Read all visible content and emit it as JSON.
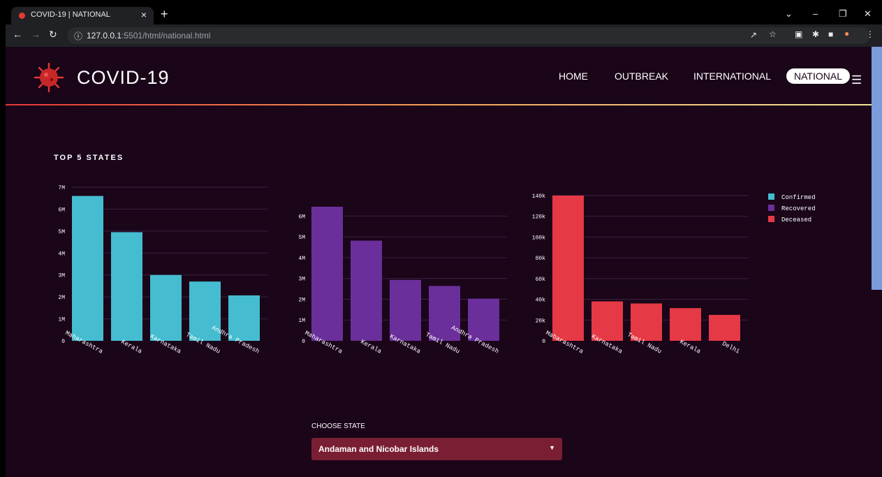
{
  "browser": {
    "tab_title": "COVID-19 | NATIONAL",
    "tab_close": "×",
    "new_tab": "+",
    "url_host": "127.0.0.1",
    "url_rest": ":5501/html/national.html"
  },
  "site": {
    "brand": "COVID-19",
    "nav": [
      "HOME",
      "OUTBREAK",
      "INTERNATIONAL",
      "NATIONAL"
    ],
    "active_nav": "NATIONAL",
    "section_title": "TOP 5 STATES",
    "choose_label": "CHOOSE STATE",
    "selected_state": "Andaman and Nicobar Islands"
  },
  "colors": {
    "confirmed": "#45bcd0",
    "recovered": "#6a2f9a",
    "deceased": "#e63946",
    "background": "#1a0519"
  },
  "chart_data": [
    {
      "type": "bar",
      "categories": [
        "Maharashtra",
        "Kerala",
        "Karnataka",
        "Tamil Nadu",
        "Andhra Pradesh"
      ],
      "values": [
        6600000,
        4950000,
        3000000,
        2700000,
        2070000
      ],
      "yticks": [
        "0",
        "1M",
        "2M",
        "3M",
        "4M",
        "5M",
        "6M",
        "7M"
      ],
      "ylim": [
        0,
        7000000
      ],
      "grid": true
    },
    {
      "type": "bar",
      "categories": [
        "Maharashtra",
        "Kerala",
        "Karnataka",
        "Tamil Nadu",
        "Andhra Pradesh"
      ],
      "values": [
        6450000,
        4820000,
        2930000,
        2640000,
        2030000
      ],
      "yticks": [
        "0",
        "1M",
        "2M",
        "3M",
        "4M",
        "5M",
        "6M"
      ],
      "ylim": [
        0,
        6450000
      ],
      "grid": true
    },
    {
      "type": "bar",
      "categories": [
        "Maharashtra",
        "Karnataka",
        "Tamil Nadu",
        "Kerala",
        "Delhi"
      ],
      "values": [
        140000,
        38000,
        36000,
        31500,
        25000
      ],
      "yticks": [
        "0",
        "20k",
        "40k",
        "60k",
        "80k",
        "100k",
        "120k",
        "140k"
      ],
      "ylim": [
        0,
        140000
      ],
      "grid": true
    }
  ],
  "legend": [
    {
      "name": "Confirmed"
    },
    {
      "name": "Recovered"
    },
    {
      "name": "Deceased"
    }
  ],
  "legend_position": "top-right"
}
